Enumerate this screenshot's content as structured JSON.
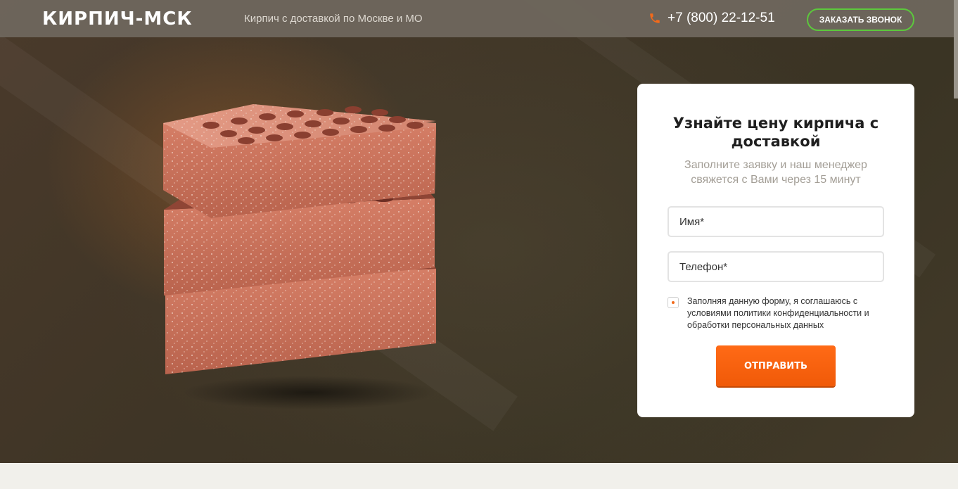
{
  "header": {
    "logo": "КИРПИЧ-МСК",
    "tagline": "Кирпич с доставкой по Москве и МО",
    "phone": "+7 (800) 22-12-51",
    "call_button": "ЗАКАЗАТЬ ЗВОНОК"
  },
  "form": {
    "title": "Узнайте цену кирпича с доставкой",
    "subtitle": "Заполните заявку и наш менеджер свяжется с Вами через 15 минут",
    "name_placeholder": "Имя*",
    "phone_placeholder": "Телефон*",
    "consent_text": "Заполняя данную форму, я соглашаюсь с условиями политики конфиденциальности и обработки персональных данных",
    "consent_checked": true,
    "submit_label": "ОТПРАВИТЬ"
  },
  "colors": {
    "accent": "#f26a1b",
    "call_border": "#5cc83c",
    "brick": "#c9705a"
  },
  "icons": {
    "phone": "phone-icon"
  }
}
